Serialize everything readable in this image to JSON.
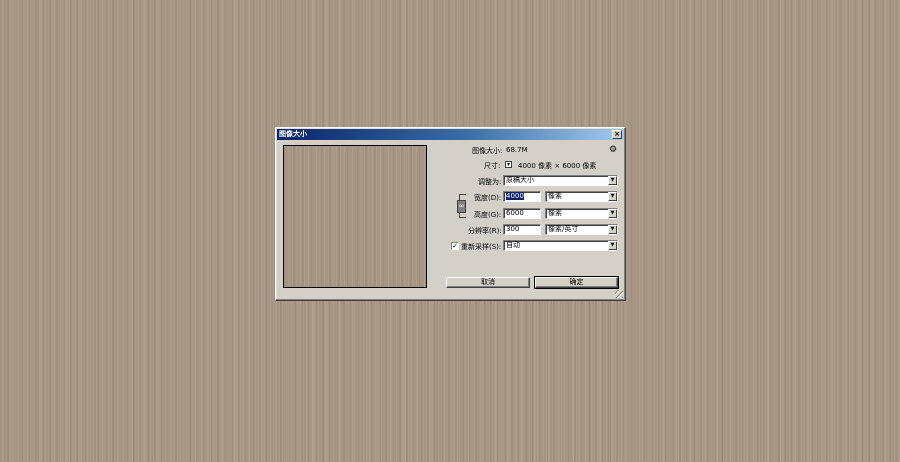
{
  "dialog": {
    "title": "图像大小",
    "close_glyph": "×",
    "image_size_label": "图像大小:",
    "image_size_value": "68.7M",
    "gear_glyph": "⚙",
    "dimensions_label": "尺寸:",
    "dimensions_toggle_glyph": "▾",
    "dimensions_value": "4000 像素  ×  6000 像素",
    "fit_to_label": "调整为:",
    "fit_to_value": "原稿大小",
    "width_label": "宽度(D):",
    "width_value": "4000",
    "width_unit": "像素",
    "height_label": "高度(G):",
    "height_value": "6000",
    "height_unit": "像素",
    "chain_glyph": "∞",
    "resolution_label": "分辨率(R):",
    "resolution_value": "300",
    "resolution_unit": "像素/英寸",
    "resample_checked_glyph": "✓",
    "resample_label": "重新采样(S):",
    "resample_value": "自动",
    "dropdown_glyph": "▼",
    "cancel_label": "取消",
    "ok_label": "确定"
  },
  "colors": {
    "title_gradient_start": "#0a246a",
    "title_gradient_end": "#a6caf0",
    "dialog_face": "#d4d0c8",
    "background_wood": "#a89684"
  }
}
